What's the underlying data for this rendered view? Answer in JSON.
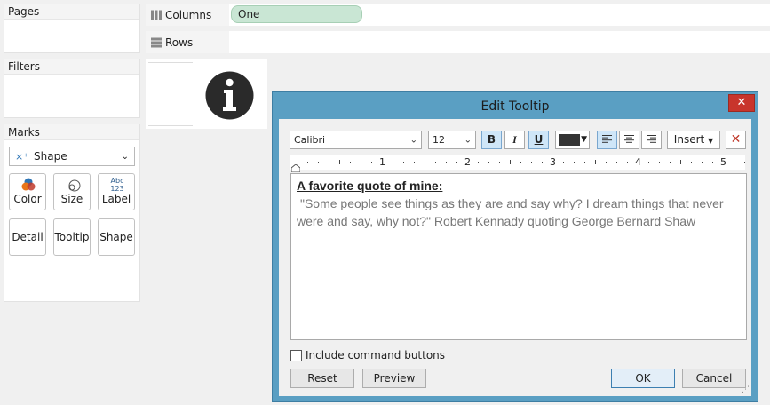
{
  "pages": {
    "title": "Pages"
  },
  "filters": {
    "title": "Filters"
  },
  "marks": {
    "title": "Marks",
    "mark_type": "Shape",
    "buttons": [
      {
        "label": "Color"
      },
      {
        "label": "Size"
      },
      {
        "label": "Label",
        "icon_text": "Abc 123"
      },
      {
        "label": "Detail"
      },
      {
        "label": "Tooltip"
      },
      {
        "label": "Shape"
      }
    ]
  },
  "shelves": {
    "columns": {
      "label": "Columns",
      "pill": "One"
    },
    "rows": {
      "label": "Rows"
    }
  },
  "dialog": {
    "title": "Edit Tooltip",
    "close": "✕",
    "font": "Calibri",
    "size": "12",
    "bold": "B",
    "italic": "I",
    "underline": "U",
    "insert": "Insert",
    "ruler_numbers": [
      "1",
      "2",
      "3",
      "4",
      "5"
    ],
    "text": {
      "heading": "A favorite quote of mine:",
      "body": "\"Some people see things as they are and say why?  I dream things that never were and say, why not?\" Robert Kennady quoting George Bernard Shaw"
    },
    "include_command_buttons": "Include command buttons",
    "reset": "Reset",
    "preview": "Preview",
    "ok": "OK",
    "cancel": "Cancel"
  },
  "colors": {
    "dialog_border": "#5a9fc3",
    "pill": "#c9e6d4",
    "close": "#c8352c"
  }
}
